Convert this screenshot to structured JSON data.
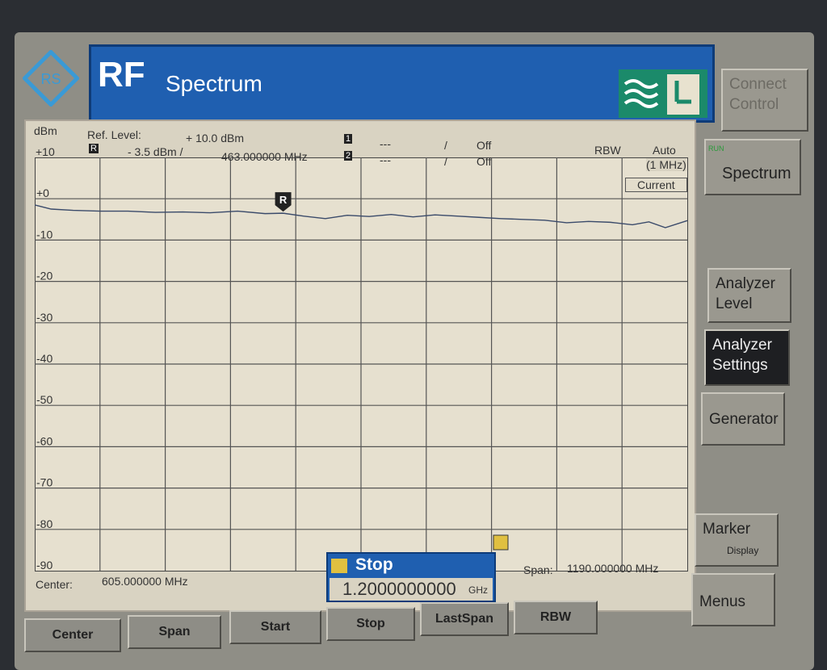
{
  "header": {
    "title_rf": "RF",
    "title": "Spectrum",
    "logo": "rohde-schwarz-logo",
    "mode_icon": "wave-hand-icon"
  },
  "top_right_button": {
    "label": "Connect Control"
  },
  "readout": {
    "unit": "dBm",
    "top_scale": "+10",
    "ref_level_label": "Ref. Level:",
    "ref_level_value": "+ 10.0  dBm",
    "ref_marker_value": "- 3.5  dBm /",
    "ref_marker_freq": "463.000000  MHz",
    "marker1_value": "---",
    "marker1_sep": "/",
    "marker1_state": "Off",
    "marker2_value": "---",
    "marker2_sep": "/",
    "marker2_state": "Off",
    "rbw_label": "RBW",
    "rbw_mode": "Auto",
    "rbw_value": "(1 MHz)",
    "trace_mode": "Current",
    "center_label": "Center:",
    "center_value": "605.000000  MHz",
    "span_label": "Span:",
    "span_value": "1190.000000  MHz"
  },
  "stop_entry": {
    "label": "Stop",
    "value": "1.2000000000",
    "unit": "GHz"
  },
  "chart_data": {
    "type": "line",
    "ylabel": "dBm",
    "ylim": [
      -90,
      10
    ],
    "xlim_mhz": [
      10,
      1200
    ],
    "y_ticks": [
      "+10",
      "+0",
      "-10",
      "-20",
      "-30",
      "-40",
      "-50",
      "-60",
      "-70",
      "-80",
      "-90"
    ],
    "grid": true,
    "x_mhz": [
      10,
      40,
      80,
      130,
      180,
      230,
      280,
      330,
      380,
      430,
      463,
      500,
      540,
      580,
      620,
      660,
      700,
      740,
      780,
      820,
      860,
      900,
      940,
      980,
      1020,
      1060,
      1100,
      1130,
      1160,
      1200
    ],
    "y_dbm": [
      -1.5,
      -2.5,
      -2.8,
      -3.0,
      -3.0,
      -3.3,
      -3.2,
      -3.4,
      -3.0,
      -3.6,
      -3.5,
      -4.2,
      -4.8,
      -4.0,
      -4.3,
      -3.8,
      -4.4,
      -3.9,
      -4.2,
      -4.5,
      -4.8,
      -5.0,
      -5.2,
      -5.8,
      -5.5,
      -5.7,
      -6.3,
      -5.6,
      -7.0,
      -5.3
    ],
    "reference_marker": {
      "label": "R",
      "x_mhz": 463,
      "y_dbm": -3.5
    }
  },
  "side_softkeys": [
    {
      "label": "Spectrum",
      "tag": "RUN"
    },
    {
      "label": "Analyzer Level"
    },
    {
      "label": "Analyzer Settings"
    },
    {
      "label": "Generator"
    },
    {
      "label": "Marker",
      "sub": "Display"
    },
    {
      "label": "Menus"
    }
  ],
  "bottom_softkeys": [
    "Center",
    "Span",
    "Start",
    "Stop",
    "LastSpan",
    "RBW"
  ]
}
